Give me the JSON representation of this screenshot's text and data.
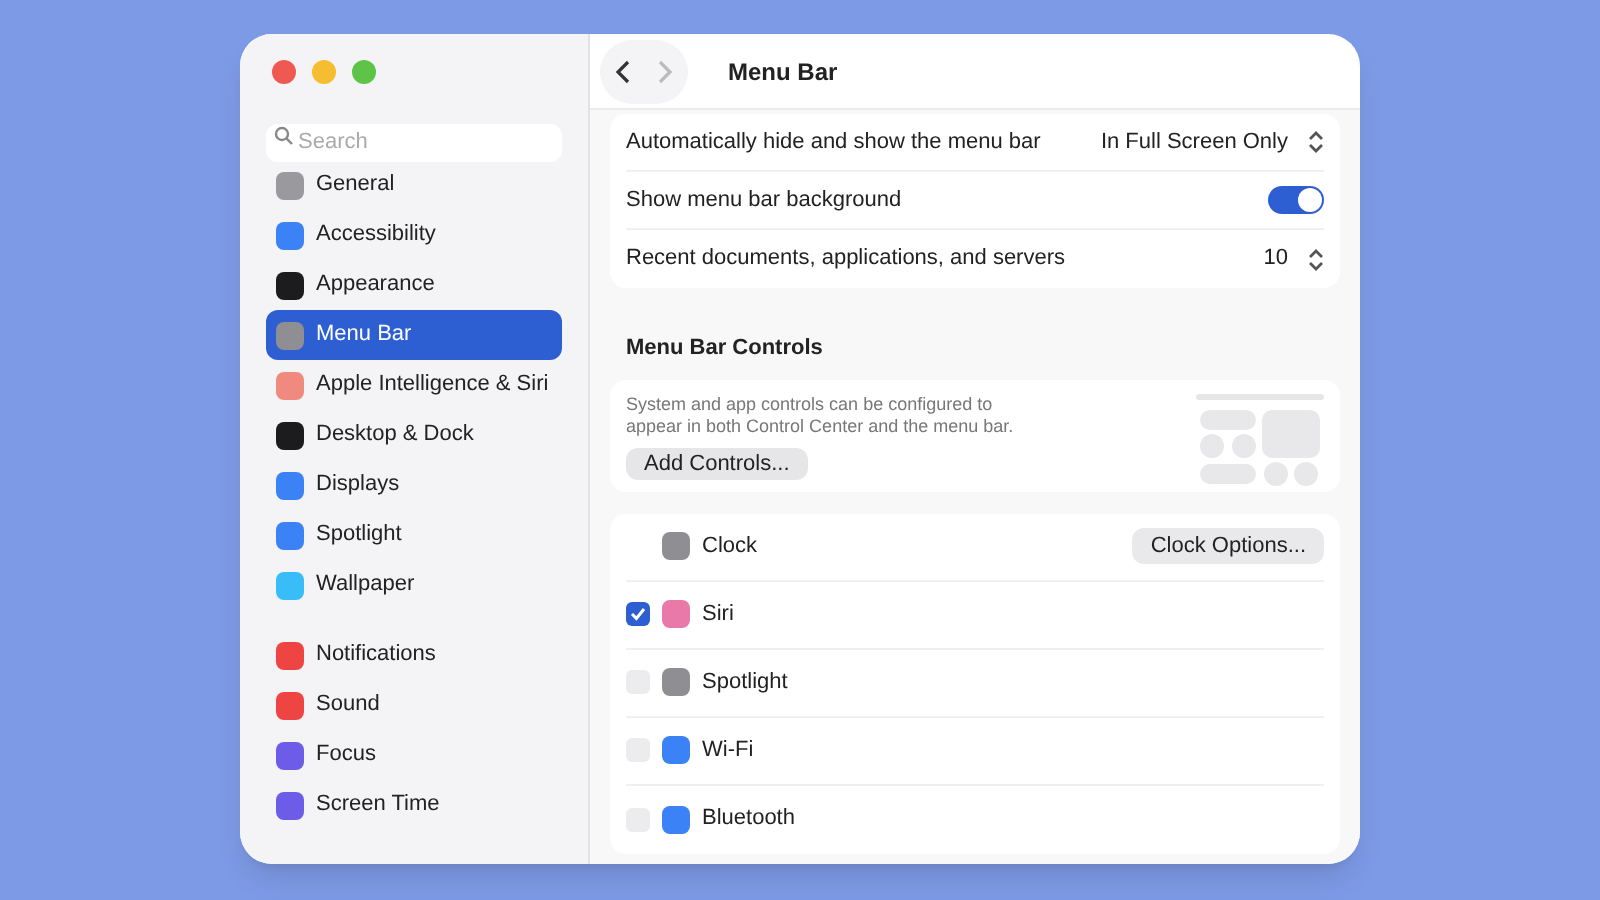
{
  "sidebar": {
    "search": {
      "placeholder": "Search"
    },
    "groups": [
      [
        {
          "label": "General",
          "selected": false,
          "color": "#9a9a9e"
        },
        {
          "label": "Accessibility",
          "selected": false,
          "color": "#3b82f6"
        },
        {
          "label": "Appearance",
          "selected": false,
          "color": "#1c1c1e"
        },
        {
          "label": "Menu Bar",
          "selected": true,
          "color": "#8e8e93"
        },
        {
          "label": "Apple Intelligence & Siri",
          "selected": false,
          "color": "#f08a7e"
        },
        {
          "label": "Desktop & Dock",
          "selected": false,
          "color": "#1c1c1e"
        },
        {
          "label": "Displays",
          "selected": false,
          "color": "#3b82f6"
        },
        {
          "label": "Spotlight",
          "selected": false,
          "color": "#3b82f6"
        },
        {
          "label": "Wallpaper",
          "selected": false,
          "color": "#38bdf8"
        }
      ],
      [
        {
          "label": "Notifications",
          "selected": false,
          "color": "#ef4444"
        },
        {
          "label": "Sound",
          "selected": false,
          "color": "#ef4444"
        },
        {
          "label": "Focus",
          "selected": false,
          "color": "#6d5ce8"
        },
        {
          "label": "Screen Time",
          "selected": false,
          "color": "#6d5ce8"
        }
      ]
    ]
  },
  "header": {
    "title": "Menu Bar"
  },
  "settings": [
    {
      "kind": "popup",
      "label": "Automatically hide and show the menu bar",
      "value": "In Full Screen Only"
    },
    {
      "kind": "toggle",
      "label": "Show menu bar background",
      "on": true
    },
    {
      "kind": "popup",
      "label": "Recent documents, applications, and servers",
      "value": "10"
    }
  ],
  "controls_section": {
    "title": "Menu Bar Controls",
    "description": "System and app controls can be configured to appear in both Control Center and the menu bar.",
    "button": "Add Controls..."
  },
  "controls": [
    {
      "kind": "button",
      "label": "Clock",
      "button": "Clock Options...",
      "color": "#8e8e93"
    },
    {
      "kind": "checkbox",
      "label": "Siri",
      "checked": true,
      "color": "#e879a8"
    },
    {
      "kind": "checkbox",
      "label": "Spotlight",
      "checked": false,
      "color": "#8e8e93"
    },
    {
      "kind": "checkbox",
      "label": "Wi-Fi",
      "checked": false,
      "color": "#3b82f6"
    },
    {
      "kind": "checkbox",
      "label": "Bluetooth",
      "checked": false,
      "color": "#3b82f6"
    }
  ]
}
